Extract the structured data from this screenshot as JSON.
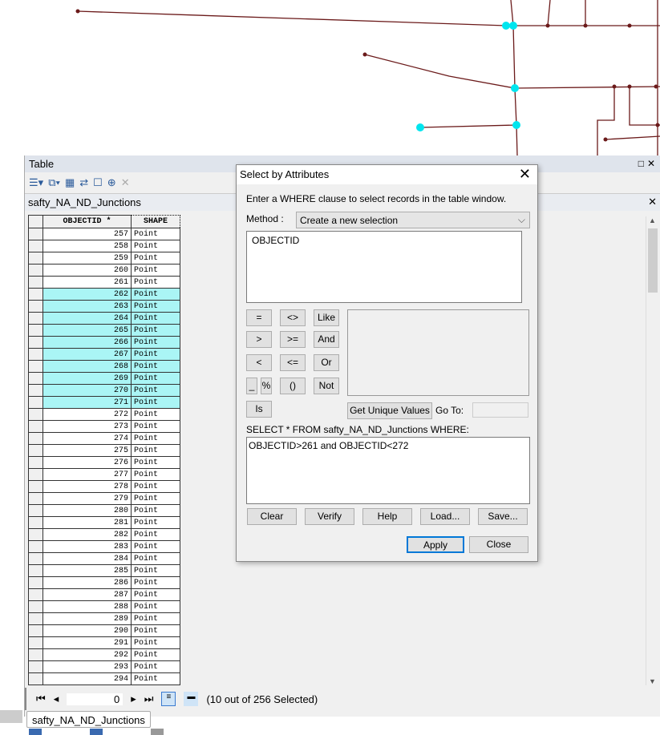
{
  "map": {
    "line_color": "#6b1a1a",
    "selected_color": "#00e5ee"
  },
  "table": {
    "title": "Table",
    "tab_name": "safty_NA_ND_Junctions",
    "columns": [
      "OBJECTID *",
      "SHAPE"
    ],
    "rows": [
      {
        "id": "257",
        "shape": "Point",
        "selected": false
      },
      {
        "id": "258",
        "shape": "Point",
        "selected": false
      },
      {
        "id": "259",
        "shape": "Point",
        "selected": false
      },
      {
        "id": "260",
        "shape": "Point",
        "selected": false
      },
      {
        "id": "261",
        "shape": "Point",
        "selected": false
      },
      {
        "id": "262",
        "shape": "Point",
        "selected": true
      },
      {
        "id": "263",
        "shape": "Point",
        "selected": true
      },
      {
        "id": "264",
        "shape": "Point",
        "selected": true
      },
      {
        "id": "265",
        "shape": "Point",
        "selected": true
      },
      {
        "id": "266",
        "shape": "Point",
        "selected": true
      },
      {
        "id": "267",
        "shape": "Point",
        "selected": true
      },
      {
        "id": "268",
        "shape": "Point",
        "selected": true
      },
      {
        "id": "269",
        "shape": "Point",
        "selected": true
      },
      {
        "id": "270",
        "shape": "Point",
        "selected": true
      },
      {
        "id": "271",
        "shape": "Point",
        "selected": true
      },
      {
        "id": "272",
        "shape": "Point",
        "selected": false
      },
      {
        "id": "273",
        "shape": "Point",
        "selected": false
      },
      {
        "id": "274",
        "shape": "Point",
        "selected": false
      },
      {
        "id": "275",
        "shape": "Point",
        "selected": false
      },
      {
        "id": "276",
        "shape": "Point",
        "selected": false
      },
      {
        "id": "277",
        "shape": "Point",
        "selected": false
      },
      {
        "id": "278",
        "shape": "Point",
        "selected": false
      },
      {
        "id": "279",
        "shape": "Point",
        "selected": false
      },
      {
        "id": "280",
        "shape": "Point",
        "selected": false
      },
      {
        "id": "281",
        "shape": "Point",
        "selected": false
      },
      {
        "id": "282",
        "shape": "Point",
        "selected": false
      },
      {
        "id": "283",
        "shape": "Point",
        "selected": false
      },
      {
        "id": "284",
        "shape": "Point",
        "selected": false
      },
      {
        "id": "285",
        "shape": "Point",
        "selected": false
      },
      {
        "id": "286",
        "shape": "Point",
        "selected": false
      },
      {
        "id": "287",
        "shape": "Point",
        "selected": false
      },
      {
        "id": "288",
        "shape": "Point",
        "selected": false
      },
      {
        "id": "289",
        "shape": "Point",
        "selected": false
      },
      {
        "id": "290",
        "shape": "Point",
        "selected": false
      },
      {
        "id": "291",
        "shape": "Point",
        "selected": false
      },
      {
        "id": "292",
        "shape": "Point",
        "selected": false
      },
      {
        "id": "293",
        "shape": "Point",
        "selected": false
      },
      {
        "id": "294",
        "shape": "Point",
        "selected": false
      }
    ],
    "highlight_color": "#aaf5f5",
    "record": "0",
    "selection_status": "(10 out of 256 Selected)",
    "bottom_tab": "safty_NA_ND_Junctions"
  },
  "dialog": {
    "title": "Select by Attributes",
    "instruction": "Enter a WHERE clause to select records in the table window.",
    "method_label": "Method :",
    "method_value": "Create a new selection",
    "fields": [
      "OBJECTID"
    ],
    "operators": [
      "=",
      "<>",
      "Like",
      ">",
      ">=",
      "And",
      "<",
      "<=",
      "Or",
      "_",
      "%",
      "()",
      "Not",
      "Is"
    ],
    "unique_values_button": "Get Unique Values",
    "goto_label": "Go To:",
    "goto_value": "",
    "sql_prefix": "SELECT * FROM safty_NA_ND_Junctions WHERE:",
    "expression": "OBJECTID>261 and OBJECTID<272",
    "buttons": [
      "Clear",
      "Verify",
      "Help",
      "Load...",
      "Save..."
    ],
    "apply": "Apply",
    "close": "Close"
  }
}
